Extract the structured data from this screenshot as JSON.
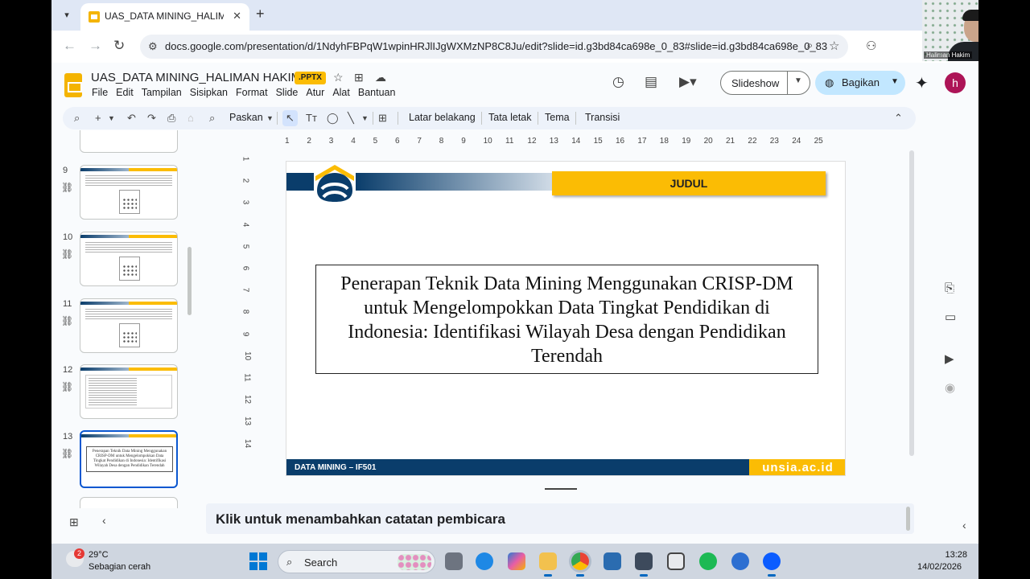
{
  "browser": {
    "tab_title": "UAS_DATA MINING_HALIMAN H",
    "new_tab": "+",
    "url": "docs.google.com/presentation/d/1NdyhFBPqW1wpinHRJlIJgWXMzNP8C8Ju/edit?slide=id.g3bd84ca698e_0_83#slide=id.g3bd84ca698e_0_83"
  },
  "docs": {
    "title": "UAS_DATA MINING_HALIMAN HAKIM",
    "badge": ".PPTX",
    "menu": [
      "File",
      "Edit",
      "Tampilan",
      "Sisipkan",
      "Format",
      "Slide",
      "Atur",
      "Alat",
      "Bantuan"
    ],
    "slideshow_label": "Slideshow",
    "share_label": "Bagikan",
    "avatar_letter": "h"
  },
  "toolbar": {
    "zoom_label": "Paskan",
    "background": "Latar belakang",
    "layout": "Tata letak",
    "theme": "Tema",
    "transition": "Transisi"
  },
  "filmstrip": {
    "slides": [
      {
        "number": "9"
      },
      {
        "number": "10"
      },
      {
        "number": "11"
      },
      {
        "number": "12"
      },
      {
        "number": "13",
        "title": "Penerapan Teknik Data Mining Menggunakan CRISP-DM untuk Mengelompokkan Data Tingkat Pendidikan di Indonesia: Identifikasi Wilayah Desa dengan Pendidikan Terendah"
      }
    ]
  },
  "ruler": {
    "horizontal": [
      "1",
      "2",
      "3",
      "4",
      "5",
      "6",
      "7",
      "8",
      "9",
      "10",
      "11",
      "12",
      "13",
      "14",
      "15",
      "16",
      "17",
      "18",
      "19",
      "20",
      "21",
      "22",
      "23",
      "24",
      "25"
    ],
    "vertical": [
      "1",
      "2",
      "3",
      "4",
      "5",
      "6",
      "7",
      "8",
      "9",
      "10",
      "11",
      "12",
      "13",
      "14"
    ]
  },
  "slide": {
    "header_label": "JUDUL",
    "title": "Penerapan Teknik Data Mining Menggunakan CRISP-DM untuk Mengelompokkan Data Tingkat Pendidikan di Indonesia: Identifikasi Wilayah Desa dengan Pendidikan Terendah",
    "footer_left": "DATA MINING – IF501",
    "footer_right": "unsia.ac.id"
  },
  "notes": {
    "placeholder": "Klik untuk menambahkan catatan pembicara"
  },
  "webcam": {
    "name": "Haliman Hakim"
  },
  "taskbar": {
    "weather_badge": "2",
    "temperature": "29°C",
    "weather": "Sebagian cerah",
    "search_label": "Search",
    "time": "13:28",
    "date": "14/02/2026",
    "apps": [
      "task-view",
      "edge",
      "copilot",
      "file-explorer",
      "chrome",
      "app-5",
      "snipping-tool",
      "app-7",
      "spotify",
      "app-9",
      "zoom"
    ]
  },
  "colors": {
    "navy": "#0a3d6b",
    "gold": "#fbbc04",
    "share_blue": "#c2e7ff",
    "selected_border": "#0b57d0"
  }
}
